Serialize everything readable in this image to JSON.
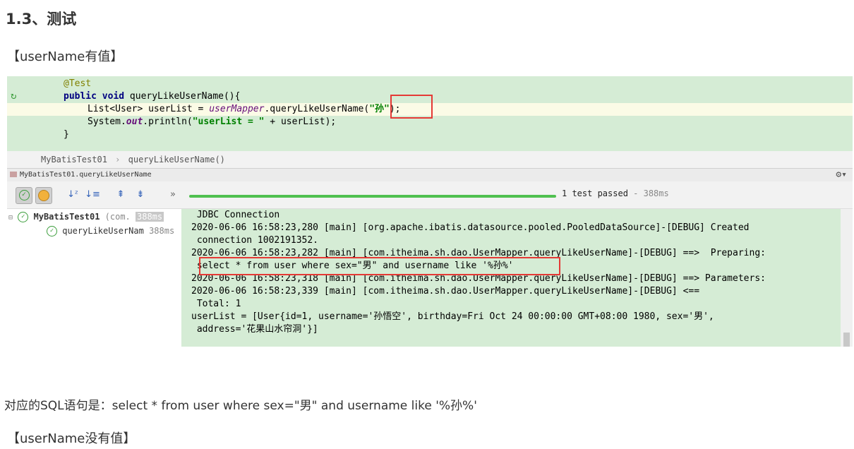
{
  "heading": "1.3、测试",
  "section_has_value": "【userName有值】",
  "section_no_value": "【userName没有值】",
  "sql_text": "对应的SQL语句是：select * from user where sex=\"男\" and username like '%孙%'",
  "editor": {
    "line_annotation": "@Test",
    "line_signature_kw": "public void ",
    "line_signature_rest": "queryLikeUserName(){",
    "line3_a": "List<User> userList = ",
    "line3_field": "userMapper",
    "line3_b": ".queryLikeUserName(",
    "line3_arg": "\"孙\"",
    "line3_c": ");",
    "line4_a": "System.",
    "line4_field": "out",
    "line4_b": ".println(",
    "line4_str": "\"userList = \"",
    "line4_c": " + userList);",
    "line_close": "}"
  },
  "breadcrumb": {
    "class_name": "MyBatisTest01",
    "separator": "›",
    "method": "queryLikeUserName()"
  },
  "run_tab": "MyBatisTest01.queryLikeUserName",
  "toolbar": {
    "expand_label": "»",
    "result_text": "1 test passed",
    "result_time": " - 388ms"
  },
  "tree": {
    "root_label": "MyBatisTest01",
    "root_pkg": "(com.",
    "root_time": "388ms",
    "child_label": "queryLikeUserNam",
    "child_time": "388ms"
  },
  "console": {
    "lines": [
      " JDBC Connection",
      "2020-06-06 16:58:23,280 [main] [org.apache.ibatis.datasource.pooled.PooledDataSource]-[DEBUG] Created",
      " connection 1002191352.",
      "2020-06-06 16:58:23,282 [main] [com.itheima.sh.dao.UserMapper.queryLikeUserName]-[DEBUG] ==>  Preparing:",
      " select * from user where sex=\"男\" and username like '%孙%'",
      "2020-06-06 16:58:23,318 [main] [com.itheima.sh.dao.UserMapper.queryLikeUserName]-[DEBUG] ==> Parameters:",
      "2020-06-06 16:58:23,339 [main] [com.itheima.sh.dao.UserMapper.queryLikeUserName]-[DEBUG] <==",
      " Total: 1",
      "userList = [User{id=1, username='孙悟空', birthday=Fri Oct 24 00:00:00 GMT+08:00 1980, sex='男',",
      " address='花果山水帘洞'}]"
    ]
  }
}
